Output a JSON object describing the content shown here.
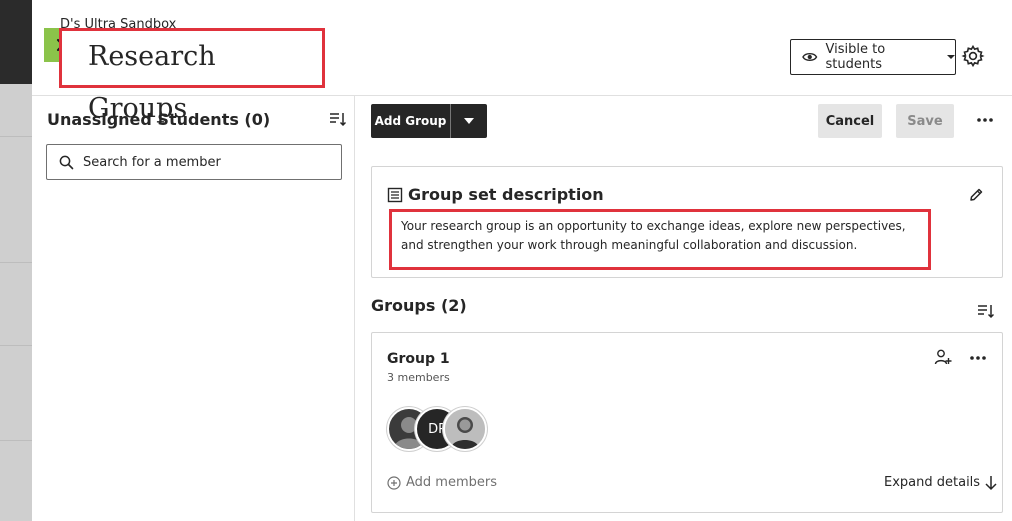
{
  "breadcrumb": "D's Ultra Sandbox",
  "header": {
    "title": "Research Groups",
    "visibility_label": "Visible to students",
    "close_icon": "close-icon",
    "settings_icon": "gear-icon"
  },
  "left": {
    "title": "Unassigned Students (0)",
    "search_placeholder": "Search for a member"
  },
  "toolbar": {
    "add_group_label": "Add Group",
    "cancel_label": "Cancel",
    "save_label": "Save"
  },
  "description": {
    "title": "Group set description",
    "text": "Your research group is an opportunity to exchange ideas, explore new perspectives, and strengthen your work through meaningful collaboration and discussion."
  },
  "groups": {
    "title": "Groups (2)",
    "items": [
      {
        "name": "Group 1",
        "members": "3 members",
        "avatars": [
          "",
          "DP",
          ""
        ],
        "add_members_label": "Add members",
        "expand_label": "Expand details"
      }
    ]
  },
  "colors": {
    "accent_green": "#8bc34a",
    "highlight_red": "#e0323c",
    "dark": "#262626"
  }
}
